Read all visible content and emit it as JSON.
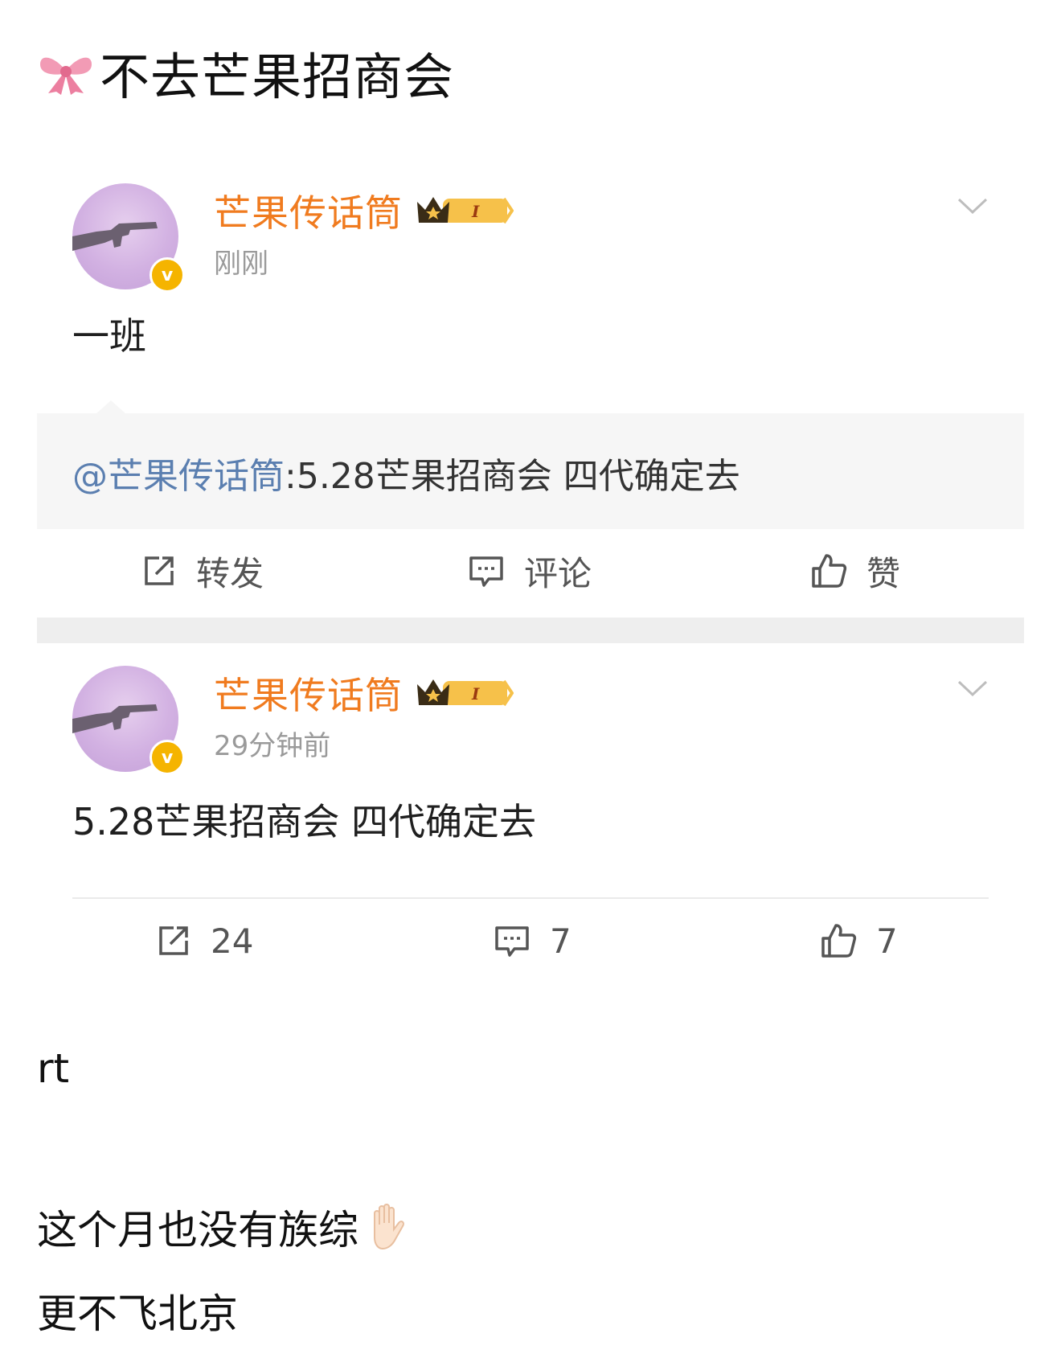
{
  "page": {
    "title": "不去芒果招商会",
    "title_icon": "ribbon-bow-icon"
  },
  "posts": [
    {
      "username": "芒果传话筒",
      "vip_level": "I",
      "timestamp": "刚刚",
      "text": "一班",
      "repost": {
        "mention": "@芒果传话筒",
        "text": ":5.28芒果招商会 四代确定去"
      },
      "actions": {
        "repost_label": "转发",
        "comment_label": "评论",
        "like_label": "赞"
      }
    },
    {
      "username": "芒果传话筒",
      "vip_level": "I",
      "timestamp": "29分钟前",
      "text": "5.28芒果招商会 四代确定去",
      "actions": {
        "repost_count": "24",
        "comment_count": "7",
        "like_count": "7"
      }
    }
  ],
  "body": {
    "line1": "rt",
    "line2": "这个月也没有族综",
    "line3": "更不飞北京"
  },
  "colors": {
    "username": "#f07b1f",
    "mention": "#5b7fb0",
    "timestamp": "#9a9a9a",
    "badge": "#f5b400"
  }
}
